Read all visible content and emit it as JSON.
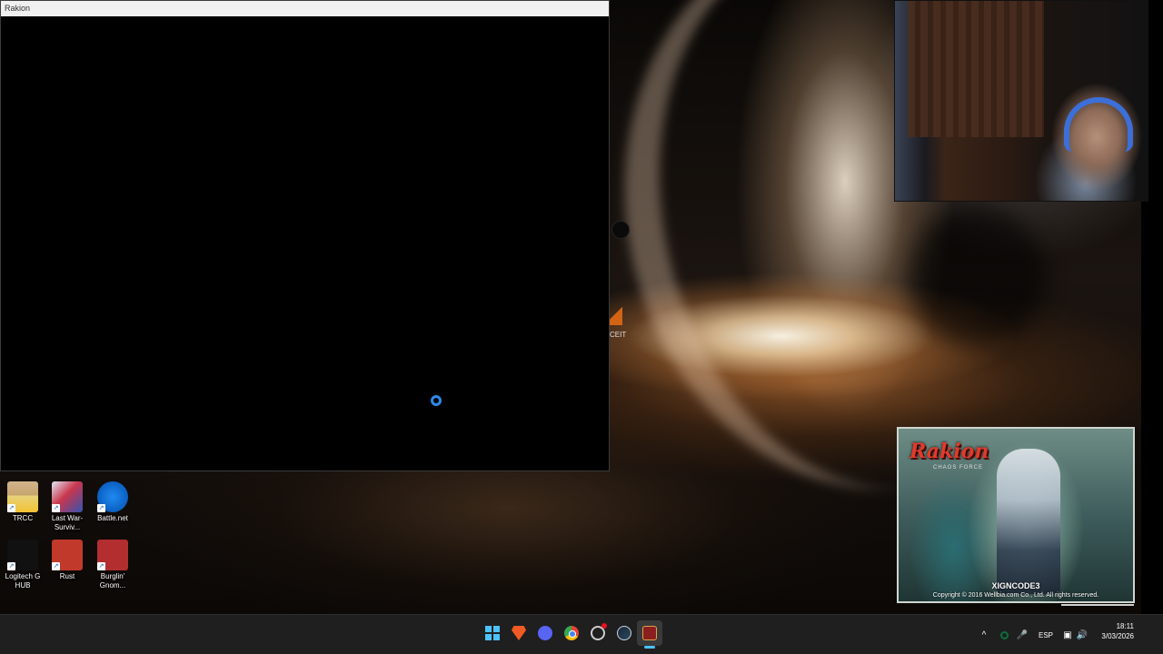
{
  "game_window": {
    "title": "Rakion"
  },
  "partial_icon": {
    "label": "CEIT"
  },
  "desktop_icons": [
    {
      "id": "trcc",
      "label": "TRCC",
      "icon": "trcc-icon"
    },
    {
      "id": "lastwar",
      "label": "Last War-Surviv...",
      "icon": "last-war-icon"
    },
    {
      "id": "battlenet",
      "label": "Battle.net",
      "icon": "battlenet-icon"
    },
    {
      "id": "logitech",
      "label": "Logitech G HUB",
      "icon": "logitech-g-hub-icon"
    },
    {
      "id": "rust",
      "label": "Rust",
      "icon": "rust-icon"
    },
    {
      "id": "burglin",
      "label": "Burglin' Gnom...",
      "icon": "burglin-gnomes-icon"
    }
  ],
  "splash": {
    "logo": "Rakion",
    "subtitle": "CHAOS FORCE",
    "anticheat": "XIGNCODE3",
    "copyright": "Copyright © 2016 Wellbia.com Co., Ltd. All rights reserved."
  },
  "taskbar": {
    "apps": [
      "windows-start-icon",
      "brave-icon",
      "discord-icon",
      "chrome-icon",
      "app-icon",
      "steam-icon",
      "rakion-icon"
    ],
    "tray": {
      "chevron": "^",
      "language": "ESP",
      "time": "18:11",
      "date": "3/03/2026"
    }
  },
  "colors": {
    "taskbar": "#1f1f1f",
    "accent": "#4cc2ff",
    "spinner": "#2b8ae6"
  }
}
